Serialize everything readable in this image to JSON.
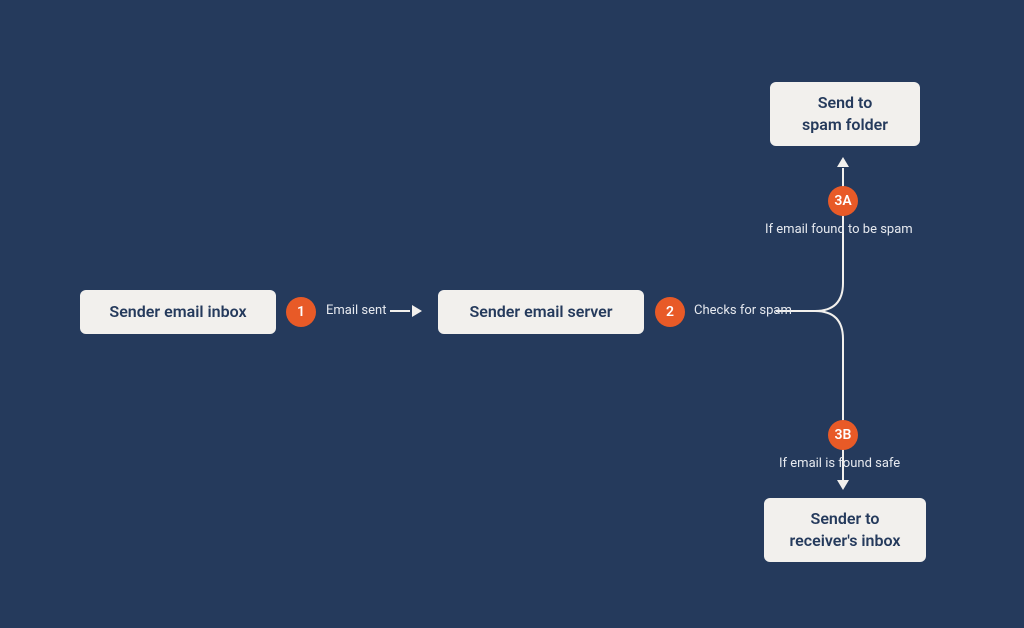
{
  "colors": {
    "background": "#253a5c",
    "node_bg": "#f2f0ed",
    "node_text": "#253a5c",
    "accent": "#e85a27",
    "label_text": "#e6e9ef",
    "connector": "#f2f0ed"
  },
  "nodes": {
    "sender_inbox": "Sender email inbox",
    "sender_server": "Sender email server",
    "spam_folder": "Send to\nspam folder",
    "receiver_inbox": "Sender to\nreceiver's inbox"
  },
  "steps": {
    "step1": {
      "badge": "1",
      "label": "Email sent"
    },
    "step2": {
      "badge": "2",
      "label": "Checks for spam"
    },
    "step3a": {
      "badge": "3A",
      "label": "If email found to be spam"
    },
    "step3b": {
      "badge": "3B",
      "label": "If email is found safe"
    }
  }
}
